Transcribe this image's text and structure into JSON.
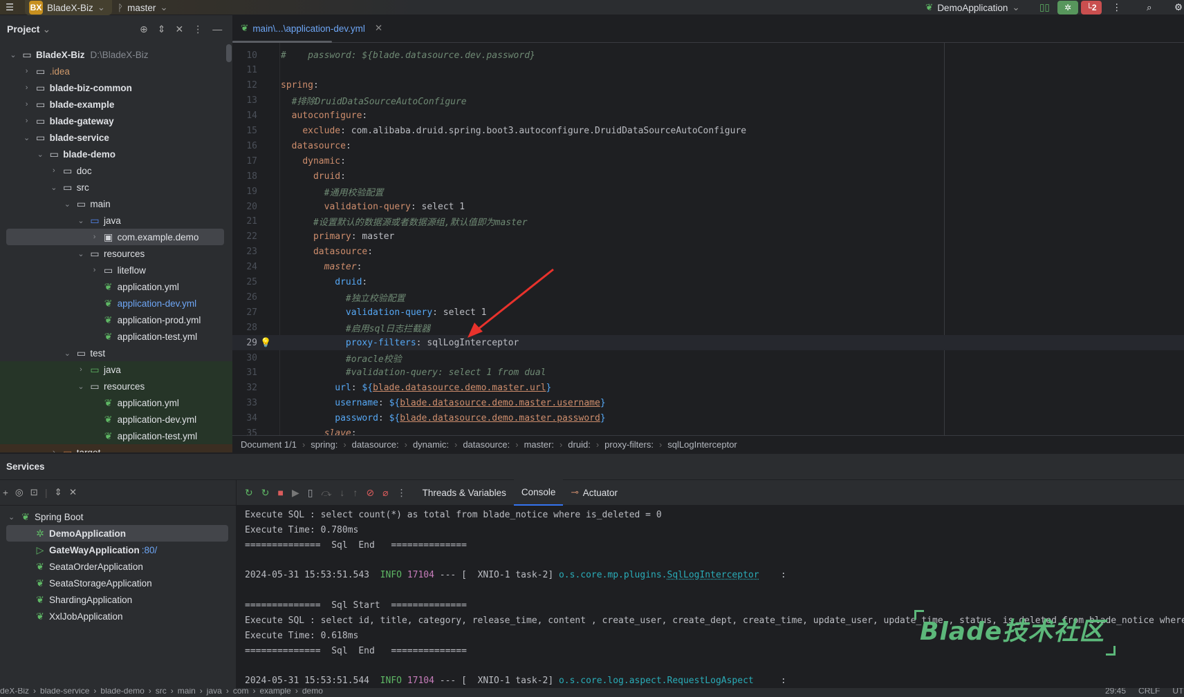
{
  "titlebar": {
    "project_badge": "BX",
    "project_name": "BladeX-Biz",
    "branch": "master",
    "run_config": "DemoApplication",
    "problems_count": "2"
  },
  "colors": {
    "accent": "#3574f0",
    "green": "#5fb865",
    "red": "#db5c5c",
    "key_orange": "#cf8e6d",
    "key_blue": "#56a8f5",
    "comment": "#7a8c7e"
  },
  "project_panel": {
    "title": "Project"
  },
  "editor_tab": {
    "label": "main\\...\\application-dev.yml"
  },
  "tree": [
    {
      "label": "BladeX-Biz",
      "hint": "D:\\BladeX-Biz",
      "depth": 0,
      "arrow": "v",
      "icon": "module",
      "bold": true
    },
    {
      "label": ".idea",
      "depth": 1,
      "arrow": ">",
      "icon": "folder",
      "color": "#d09a6b"
    },
    {
      "label": "blade-biz-common",
      "depth": 1,
      "arrow": ">",
      "icon": "module",
      "bold": true
    },
    {
      "label": "blade-example",
      "depth": 1,
      "arrow": ">",
      "icon": "module",
      "bold": true
    },
    {
      "label": "blade-gateway",
      "depth": 1,
      "arrow": ">",
      "icon": "module",
      "bold": true
    },
    {
      "label": "blade-service",
      "depth": 1,
      "arrow": "v",
      "icon": "module",
      "bold": true
    },
    {
      "label": "blade-demo",
      "depth": 2,
      "arrow": "v",
      "icon": "module",
      "bold": true
    },
    {
      "label": "doc",
      "depth": 3,
      "arrow": ">",
      "icon": "folder"
    },
    {
      "label": "src",
      "depth": 3,
      "arrow": "v",
      "icon": "folder"
    },
    {
      "label": "main",
      "depth": 4,
      "arrow": "v",
      "icon": "folder"
    },
    {
      "label": "java",
      "depth": 5,
      "arrow": "v",
      "icon": "folder-blue"
    },
    {
      "label": "com.example.demo",
      "depth": 6,
      "arrow": ">",
      "icon": "package",
      "selected": true
    },
    {
      "label": "resources",
      "depth": 5,
      "arrow": "v",
      "icon": "resources"
    },
    {
      "label": "liteflow",
      "depth": 6,
      "arrow": ">",
      "icon": "folder"
    },
    {
      "label": "application.yml",
      "depth": 6,
      "arrow": "",
      "icon": "spring"
    },
    {
      "label": "application-dev.yml",
      "depth": 6,
      "arrow": "",
      "icon": "spring",
      "color": "#6ea6f5"
    },
    {
      "label": "application-prod.yml",
      "depth": 6,
      "arrow": "",
      "icon": "spring"
    },
    {
      "label": "application-test.yml",
      "depth": 6,
      "arrow": "",
      "icon": "spring"
    },
    {
      "label": "test",
      "depth": 4,
      "arrow": "v",
      "icon": "folder"
    },
    {
      "label": "java",
      "depth": 5,
      "arrow": ">",
      "icon": "folder-green",
      "bg": "test"
    },
    {
      "label": "resources",
      "depth": 5,
      "arrow": "v",
      "icon": "resources",
      "bg": "test"
    },
    {
      "label": "application.yml",
      "depth": 6,
      "arrow": "",
      "icon": "spring",
      "bg": "test"
    },
    {
      "label": "application-dev.yml",
      "depth": 6,
      "arrow": "",
      "icon": "spring",
      "bg": "test"
    },
    {
      "label": "application-test.yml",
      "depth": 6,
      "arrow": "",
      "icon": "spring",
      "bg": "test"
    },
    {
      "label": "target",
      "depth": 3,
      "arrow": ">",
      "icon": "folder-orange",
      "bg": "excluded"
    }
  ],
  "code": [
    {
      "n": "10",
      "t": [
        [
          "#    password: ${blade.datasource.dev.password}",
          "c"
        ]
      ]
    },
    {
      "n": "11",
      "t": []
    },
    {
      "n": "12",
      "t": [
        [
          "spring",
          "k"
        ],
        [
          ":",
          "p"
        ]
      ]
    },
    {
      "n": "13",
      "t": [
        [
          "  ",
          "p"
        ],
        [
          "#排除DruidDataSourceAutoConfigure",
          "c"
        ]
      ]
    },
    {
      "n": "14",
      "t": [
        [
          "  ",
          "p"
        ],
        [
          "autoconfigure",
          "k"
        ],
        [
          ":",
          "p"
        ]
      ]
    },
    {
      "n": "15",
      "t": [
        [
          "    ",
          "p"
        ],
        [
          "exclude",
          "k"
        ],
        [
          ": com.alibaba.druid.spring.boot3.autoconfigure.DruidDataSourceAutoConfigure",
          "p"
        ]
      ]
    },
    {
      "n": "16",
      "t": [
        [
          "  ",
          "p"
        ],
        [
          "datasource",
          "k"
        ],
        [
          ":",
          "p"
        ]
      ]
    },
    {
      "n": "17",
      "t": [
        [
          "    ",
          "p"
        ],
        [
          "dynamic",
          "k"
        ],
        [
          ":",
          "p"
        ]
      ]
    },
    {
      "n": "18",
      "t": [
        [
          "      ",
          "p"
        ],
        [
          "druid",
          "k"
        ],
        [
          ":",
          "p"
        ]
      ]
    },
    {
      "n": "19",
      "t": [
        [
          "        ",
          "p"
        ],
        [
          "#通用校验配置",
          "c"
        ]
      ]
    },
    {
      "n": "20",
      "t": [
        [
          "        ",
          "p"
        ],
        [
          "validation-query",
          "k"
        ],
        [
          ": select 1",
          "p"
        ]
      ]
    },
    {
      "n": "21",
      "t": [
        [
          "      ",
          "p"
        ],
        [
          "#设置默认的数据源或者数据源组,默认值即为master",
          "c"
        ]
      ]
    },
    {
      "n": "22",
      "t": [
        [
          "      ",
          "p"
        ],
        [
          "primary",
          "k"
        ],
        [
          ": master",
          "p"
        ]
      ]
    },
    {
      "n": "23",
      "t": [
        [
          "      ",
          "p"
        ],
        [
          "datasource",
          "k"
        ],
        [
          ":",
          "p"
        ]
      ]
    },
    {
      "n": "24",
      "t": [
        [
          "        ",
          "p"
        ],
        [
          "master",
          "ki"
        ],
        [
          ":",
          "p"
        ]
      ]
    },
    {
      "n": "25",
      "t": [
        [
          "          ",
          "p"
        ],
        [
          "druid",
          "b"
        ],
        [
          ":",
          "p"
        ]
      ]
    },
    {
      "n": "26",
      "t": [
        [
          "            ",
          "p"
        ],
        [
          "#独立校验配置",
          "c"
        ]
      ]
    },
    {
      "n": "27",
      "t": [
        [
          "            ",
          "p"
        ],
        [
          "validation-query",
          "b"
        ],
        [
          ": select 1",
          "p"
        ]
      ]
    },
    {
      "n": "28",
      "t": [
        [
          "            ",
          "p"
        ],
        [
          "#启用sql日志拦截器",
          "c"
        ]
      ]
    },
    {
      "n": "29",
      "t": [
        [
          "            ",
          "p"
        ],
        [
          "proxy-filters",
          "b"
        ],
        [
          ": sqlLogInterceptor",
          "p"
        ]
      ],
      "current": true
    },
    {
      "n": "30",
      "t": [
        [
          "            ",
          "p"
        ],
        [
          "#oracle校验",
          "c"
        ]
      ]
    },
    {
      "n": "31",
      "t": [
        [
          "            ",
          "p"
        ],
        [
          "#validation-query: select 1 from dual",
          "c"
        ]
      ]
    },
    {
      "n": "32",
      "t": [
        [
          "          ",
          "p"
        ],
        [
          "url",
          "b"
        ],
        [
          ": ",
          "p"
        ],
        [
          "${",
          "b"
        ],
        [
          "blade.datasource.demo.master.url",
          "u"
        ],
        [
          "}",
          "b"
        ]
      ]
    },
    {
      "n": "33",
      "t": [
        [
          "          ",
          "p"
        ],
        [
          "username",
          "b"
        ],
        [
          ": ",
          "p"
        ],
        [
          "${",
          "b"
        ],
        [
          "blade.datasource.demo.master.username",
          "u"
        ],
        [
          "}",
          "b"
        ]
      ]
    },
    {
      "n": "34",
      "t": [
        [
          "          ",
          "p"
        ],
        [
          "password",
          "b"
        ],
        [
          ": ",
          "p"
        ],
        [
          "${",
          "b"
        ],
        [
          "blade.datasource.demo.master.password",
          "u"
        ],
        [
          "}",
          "b"
        ]
      ]
    },
    {
      "n": "35",
      "t": [
        [
          "        ",
          "p"
        ],
        [
          "slave",
          "ki"
        ],
        [
          ":",
          "p"
        ]
      ]
    }
  ],
  "breadcrumbs": [
    "Document 1/1",
    "spring:",
    "datasource:",
    "dynamic:",
    "datasource:",
    "master:",
    "druid:",
    "proxy-filters:",
    "sqlLogInterceptor"
  ],
  "services": {
    "title": "Services",
    "group": "Spring Boot",
    "items": [
      {
        "label": "DemoApplication",
        "bold": true,
        "icon": "debug",
        "selected": true
      },
      {
        "label": "GateWayApplication",
        "bold": true,
        "icon": "run",
        "suffix": ":80/"
      },
      {
        "label": "SeataOrderApplication",
        "icon": "spring"
      },
      {
        "label": "SeataStorageApplication",
        "icon": "spring"
      },
      {
        "label": "ShardingApplication",
        "icon": "spring"
      },
      {
        "label": "XxlJobApplication",
        "icon": "spring"
      }
    ]
  },
  "console_tabs": [
    {
      "label": "Threads & Variables"
    },
    {
      "label": "Console",
      "active": true
    },
    {
      "label": "Actuator"
    }
  ],
  "console": [
    [
      [
        "Execute SQL : select count(*) as total from blade_notice where is_deleted = 0",
        "p"
      ]
    ],
    [
      [
        "Execute Time: 0.780ms",
        "p"
      ]
    ],
    [
      [
        "==============  Sql  End   ==============",
        "p"
      ]
    ],
    [],
    [
      [
        "2024-05-31 15:53:51.543  ",
        "p"
      ],
      [
        "INFO",
        "g"
      ],
      [
        " ",
        "p"
      ],
      [
        "17104",
        "m"
      ],
      [
        " --- [  XNIO-1 task-2] ",
        "p"
      ],
      [
        "o.s.core.mp.plugins.",
        "t"
      ],
      [
        "SqlLogInterceptor",
        "tu"
      ],
      [
        "    :",
        "p"
      ]
    ],
    [],
    [
      [
        "==============  Sql Start  ==============",
        "p"
      ]
    ],
    [
      [
        "Execute SQL : select id, title, category, release_time, content , create_user, create_dept, create_time, update_user, update_time , status, is_deleted from blade_notice where",
        "p"
      ]
    ],
    [
      [
        "Execute Time: 0.618ms",
        "p"
      ]
    ],
    [
      [
        "==============  Sql  End   ==============",
        "p"
      ]
    ],
    [],
    [
      [
        "2024-05-31 15:53:51.544  ",
        "p"
      ],
      [
        "INFO",
        "g"
      ],
      [
        " ",
        "p"
      ],
      [
        "17104",
        "m"
      ],
      [
        " --- [  XNIO-1 task-2] ",
        "p"
      ],
      [
        "o.s.core.log.aspect.RequestLogAspect",
        "t"
      ],
      [
        "     :",
        "p"
      ]
    ]
  ],
  "watermark": "Blade技术社区",
  "statusbar": {
    "path": [
      "deX-Biz",
      "blade-service",
      "blade-demo",
      "src",
      "main",
      "java",
      "com",
      "example",
      "demo"
    ],
    "position": "29:45",
    "line_sep": "CRLF",
    "encoding": "UT"
  }
}
